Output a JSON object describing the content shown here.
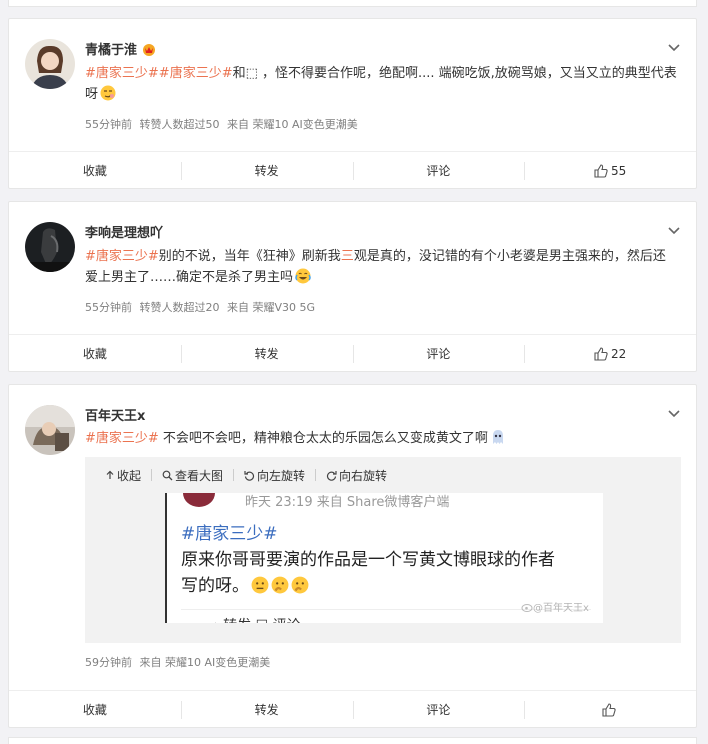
{
  "posts": [
    {
      "name": "青橘于淮",
      "text": {
        "tag1": "#唐家三少#",
        "tag2": "#唐家三少#",
        "t1": "和⬚ ，怪不得要合作呢，绝配啊.... 端碗吃饭,放碗骂娘，又当又立的典型代表呀",
        "emoji": "smirk-emoji"
      },
      "meta": {
        "time": "55分钟前",
        "reposts": "转赞人数超过50",
        "source": "来自 荣耀10 AI变色更潮美"
      },
      "actions": {
        "fav": "收藏",
        "repost": "转发",
        "comment": "评论",
        "likes": "55"
      }
    },
    {
      "name": "李响是理想吖",
      "text": {
        "tag1": "#唐家三少#",
        "t1": "别的不说，当年《狂神》刷新我",
        "red": "三",
        "t2": "观是真的，没记错的有个小老婆是男主强来的，然后还爱上男主了……确定不是杀了男主吗",
        "emoji": "laugh-cry-emoji"
      },
      "meta": {
        "time": "55分钟前",
        "reposts": "转赞人数超过20",
        "source": "来自 荣耀V30 5G"
      },
      "actions": {
        "fav": "收藏",
        "repost": "转发",
        "comment": "评论",
        "likes": "22"
      }
    },
    {
      "name": "百年天王x",
      "text": {
        "tag1": "#唐家三少#",
        "t1": " 不会吧不会吧，精神粮仓太太的乐园怎么又变成黄文了啊",
        "emoji": "ghost-emoji"
      },
      "media": {
        "collapse": "收起",
        "view_large": "查看大图",
        "rotate_left": "向左旋转",
        "rotate_right": "向右旋转",
        "shot_header": "昨天 23:19  来自 Share微博客户端",
        "shot_tag": "#唐家三少#",
        "shot_line1": "原来你哥哥要演的作品是一个写黄文博眼球的作者",
        "shot_line2": "写的呀。",
        "shot_footer": "→ 转发            ☐ 评论",
        "watermark": "@百年天王x"
      },
      "meta": {
        "time": "59分钟前",
        "source": "来自 荣耀10 AI变色更潮美"
      },
      "actions": {
        "fav": "收藏",
        "repost": "转发",
        "comment": "评论",
        "likes": ""
      }
    }
  ],
  "colors": {
    "tag": "#eb7350",
    "shot_tag": "#3b6dbf",
    "meta": "#808080"
  }
}
